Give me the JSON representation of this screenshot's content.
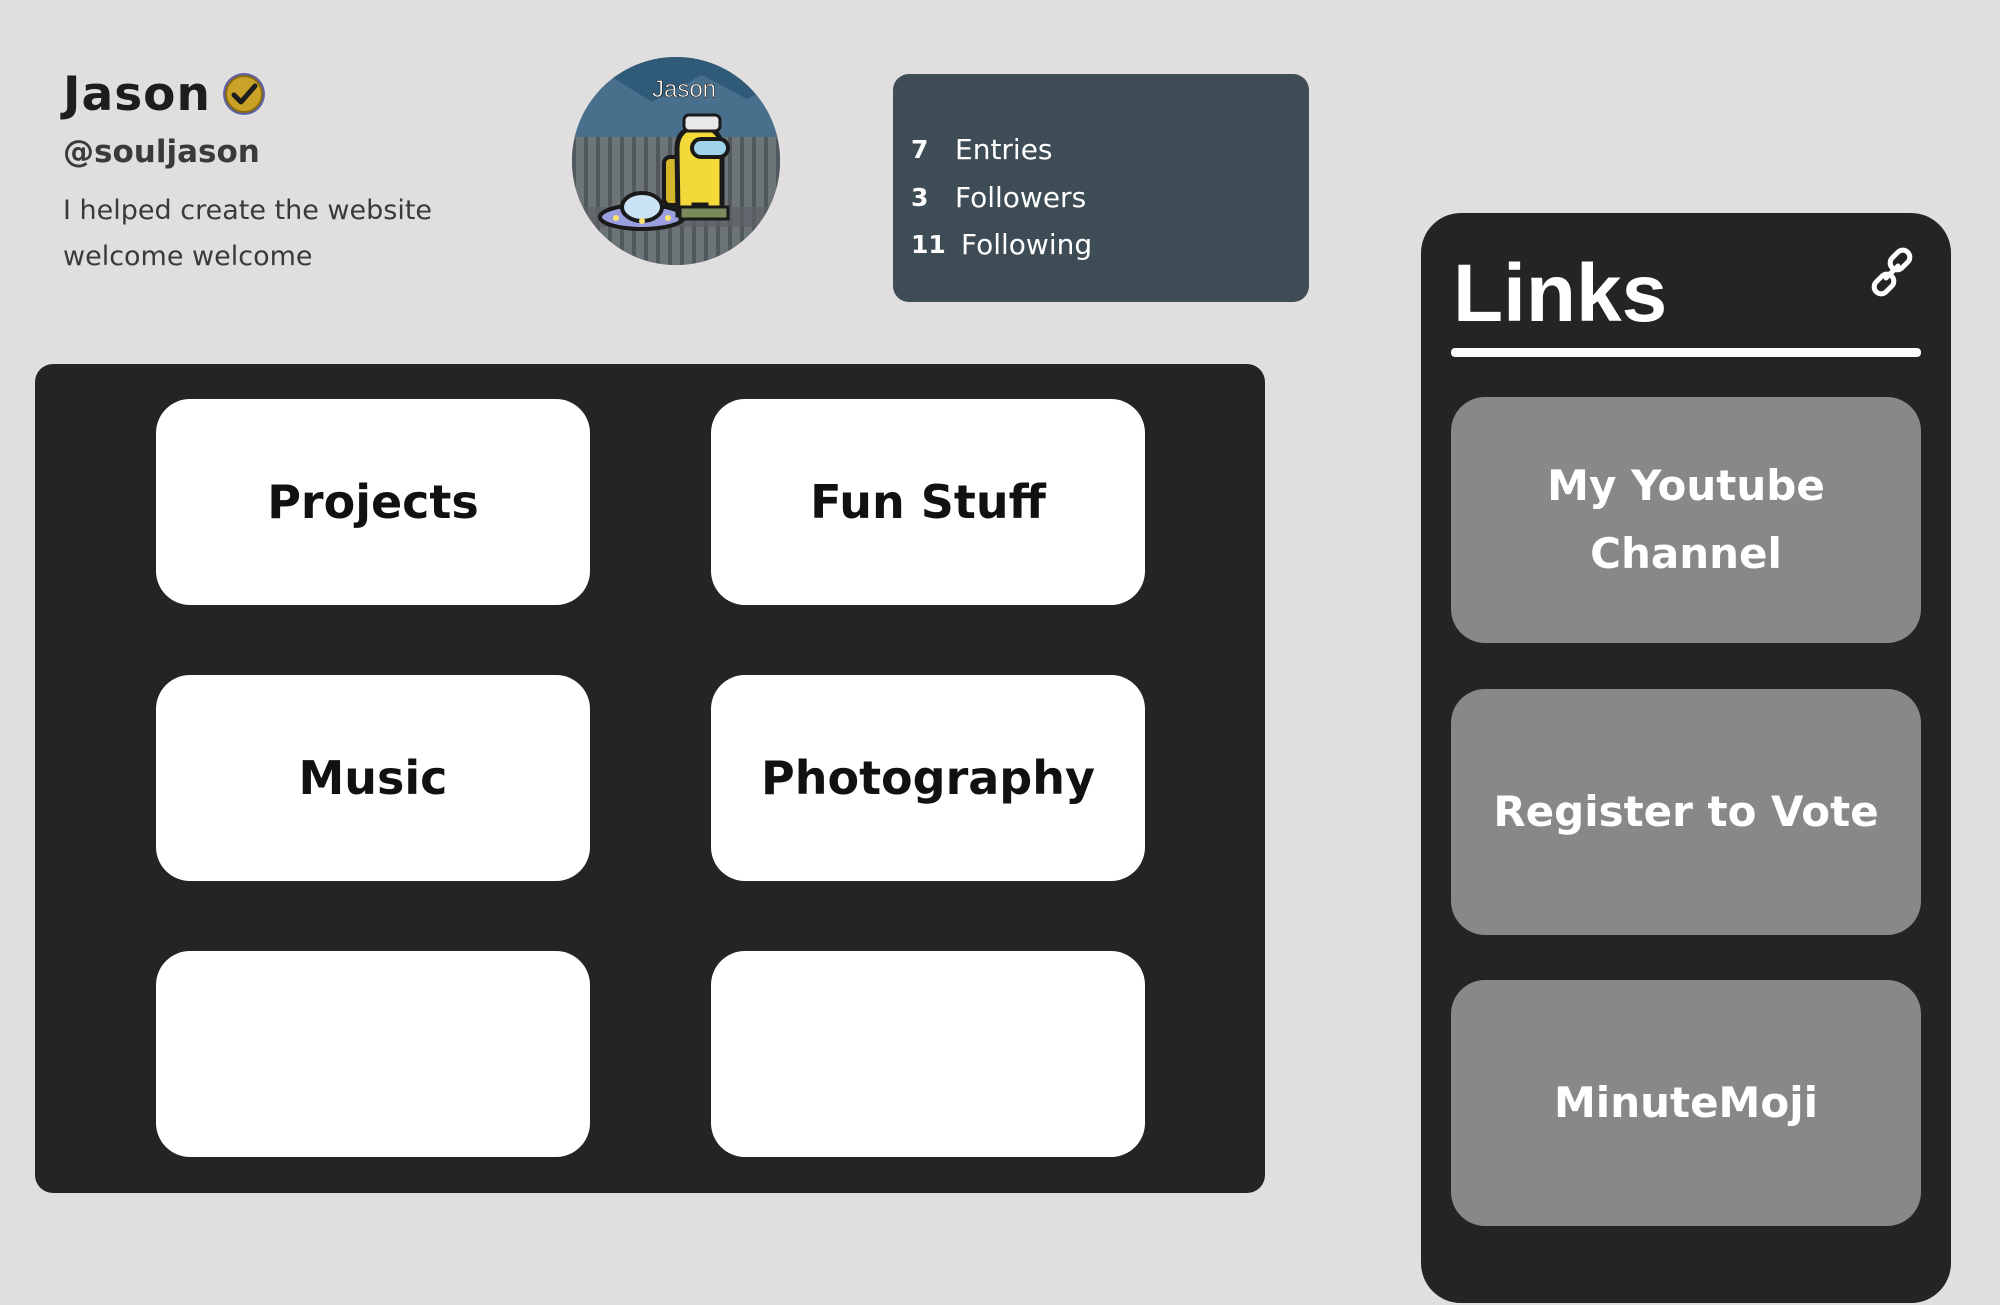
{
  "profile": {
    "name": "Jason",
    "handle": "@souljason",
    "bio_line1": "I helped create the website",
    "bio_line2": "welcome welcome",
    "avatar_caption": "Jason"
  },
  "stats": [
    {
      "value": "7",
      "label": "Entries"
    },
    {
      "value": "3",
      "label": "Followers"
    },
    {
      "value": "11",
      "label": "Following"
    }
  ],
  "categories": [
    {
      "label": "Projects"
    },
    {
      "label": "Fun Stuff"
    },
    {
      "label": "Music"
    },
    {
      "label": "Photography"
    },
    {
      "label": ""
    },
    {
      "label": ""
    }
  ],
  "links": {
    "title": "Links",
    "icon": "link-icon",
    "items": [
      {
        "label": "My Youtube Channel"
      },
      {
        "label": "Register to Vote"
      },
      {
        "label": "MinuteMoji"
      }
    ]
  },
  "colors": {
    "background": "#e0dedf",
    "stats_panel": "#3e4d55",
    "dark_panel": "#242424",
    "tile": "#ffffff",
    "link_button": "#888888",
    "verified_badge": "#c9a227"
  }
}
